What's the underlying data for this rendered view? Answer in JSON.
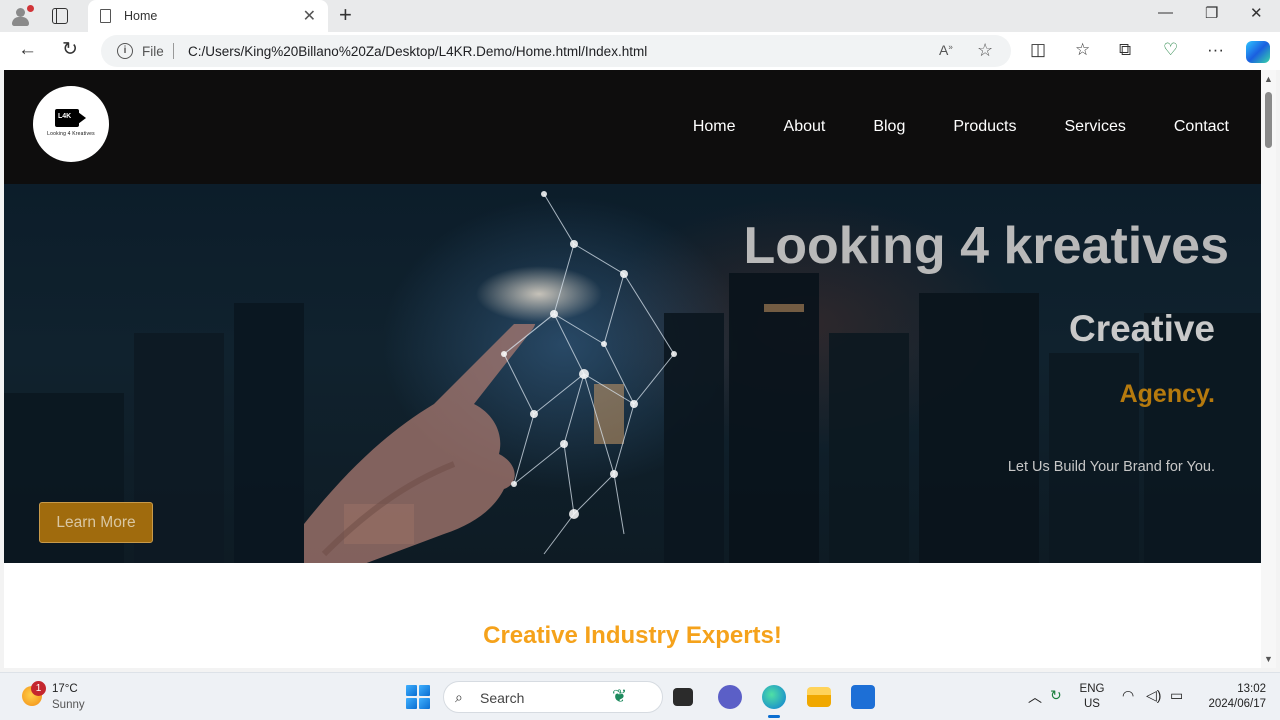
{
  "browser": {
    "tab_title": "Home",
    "address_scheme": "File",
    "url": "C:/Users/King%20Billano%20Za/Desktop/L4KR.Demo/Home.html/Index.html"
  },
  "site": {
    "logo_text": "L4K",
    "logo_caption": "Looking 4 Kreatives",
    "nav": [
      "Home",
      "About",
      "Blog",
      "Products",
      "Services",
      "Contact"
    ],
    "hero": {
      "title": "Looking 4 kreatives",
      "subtitle": "Creative",
      "agency": "Agency.",
      "tagline": "Let Us Build Your Brand for You.",
      "button": "Learn More"
    },
    "section_title": "Creative Industry Experts!"
  },
  "taskbar": {
    "weather_badge": "1",
    "temperature": "17°C",
    "condition": "Sunny",
    "search_placeholder": "Search",
    "lang_top": "ENG",
    "lang_bottom": "US",
    "time": "13:02",
    "date": "2024/06/17"
  },
  "colors": {
    "header_bg": "#0e0d0d",
    "accent_orange": "#f5a21b",
    "agency_gold": "#b67a0e",
    "button_bg": "#a06b0d"
  }
}
